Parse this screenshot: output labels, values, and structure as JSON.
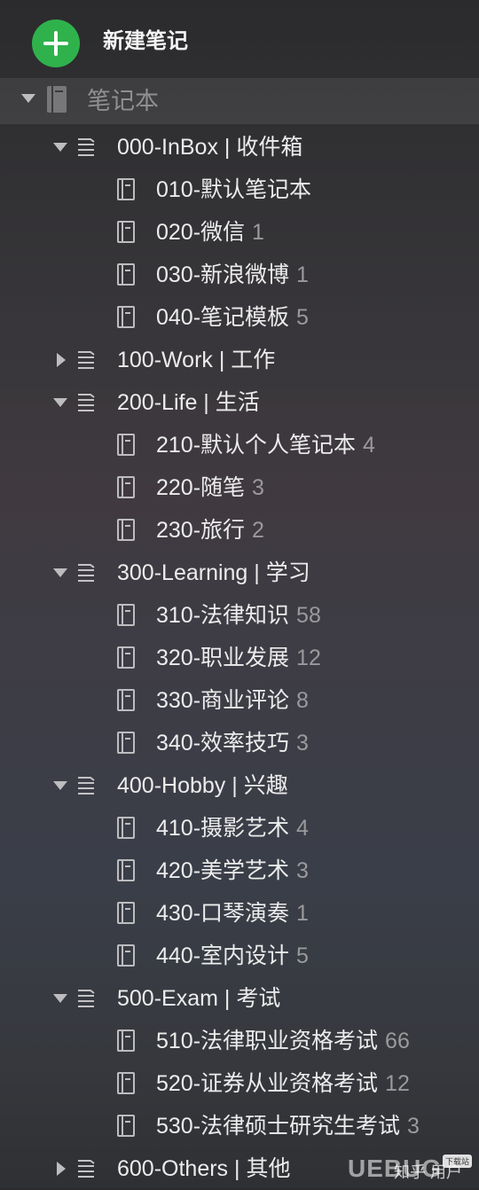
{
  "new_note": {
    "label": "新建笔记"
  },
  "section": {
    "label": "笔记本"
  },
  "tree": [
    {
      "type": "stack",
      "label": "000-InBox | 收件箱",
      "expanded": true
    },
    {
      "type": "notebook",
      "label": "010-默认笔记本",
      "count": ""
    },
    {
      "type": "notebook",
      "label": "020-微信",
      "count": "1"
    },
    {
      "type": "notebook",
      "label": "030-新浪微博",
      "count": "1"
    },
    {
      "type": "notebook",
      "label": "040-笔记模板",
      "count": "5"
    },
    {
      "type": "stack",
      "label": "100-Work | 工作",
      "expanded": false
    },
    {
      "type": "stack",
      "label": "200-Life | 生活",
      "expanded": true
    },
    {
      "type": "notebook",
      "label": "210-默认个人笔记本",
      "count": "4"
    },
    {
      "type": "notebook",
      "label": "220-随笔",
      "count": "3"
    },
    {
      "type": "notebook",
      "label": "230-旅行",
      "count": "2"
    },
    {
      "type": "stack",
      "label": "300-Learning | 学习",
      "expanded": true
    },
    {
      "type": "notebook",
      "label": "310-法律知识",
      "count": "58"
    },
    {
      "type": "notebook",
      "label": "320-职业发展",
      "count": "12"
    },
    {
      "type": "notebook",
      "label": "330-商业评论",
      "count": "8"
    },
    {
      "type": "notebook",
      "label": "340-效率技巧",
      "count": "3"
    },
    {
      "type": "stack",
      "label": "400-Hobby | 兴趣",
      "expanded": true
    },
    {
      "type": "notebook",
      "label": "410-摄影艺术",
      "count": "4"
    },
    {
      "type": "notebook",
      "label": "420-美学艺术",
      "count": "3"
    },
    {
      "type": "notebook",
      "label": "430-口琴演奏",
      "count": "1"
    },
    {
      "type": "notebook",
      "label": "440-室内设计",
      "count": "5"
    },
    {
      "type": "stack",
      "label": "500-Exam | 考试",
      "expanded": true
    },
    {
      "type": "notebook",
      "label": "510-法律职业资格考试",
      "count": "66"
    },
    {
      "type": "notebook",
      "label": "520-证券从业资格考试",
      "count": "12"
    },
    {
      "type": "notebook",
      "label": "530-法律硕士研究生考试",
      "count": "3"
    },
    {
      "type": "stack",
      "label": "600-Others | 其他",
      "expanded": false
    }
  ],
  "watermark": {
    "logo": "UEBUG",
    "text": "知乎 用户",
    "badge": "下载站"
  },
  "colors": {
    "accent": "#2fb24c",
    "text": "#ececec",
    "count": "#9a999c"
  }
}
